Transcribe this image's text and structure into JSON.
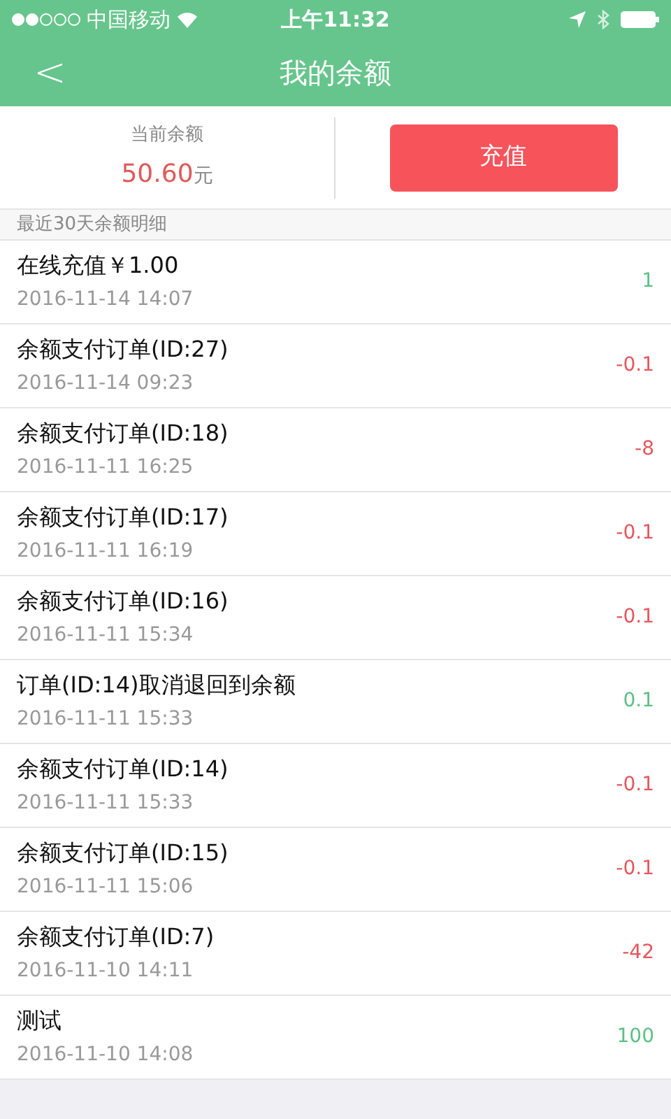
{
  "status_bar": {
    "carrier": "中国移动",
    "time": "上午11:32"
  },
  "header": {
    "back": "<",
    "title": "我的余额"
  },
  "summary": {
    "label": "当前余额",
    "amount": "50.60",
    "unit": "元",
    "button": "充值"
  },
  "section_title": "最近30天余额明细",
  "transactions": [
    {
      "title": "在线充值￥1.00",
      "time": "2016-11-14 14:07",
      "amount": "1",
      "color": "#5dbf85"
    },
    {
      "title": "余额支付订单(ID:27)",
      "time": "2016-11-14 09:23",
      "amount": "-0.1",
      "color": "#e5575c"
    },
    {
      "title": "余额支付订单(ID:18)",
      "time": "2016-11-11 16:25",
      "amount": "-8",
      "color": "#e5575c"
    },
    {
      "title": "余额支付订单(ID:17)",
      "time": "2016-11-11 16:19",
      "amount": "-0.1",
      "color": "#e5575c"
    },
    {
      "title": "余额支付订单(ID:16)",
      "time": "2016-11-11 15:34",
      "amount": "-0.1",
      "color": "#e5575c"
    },
    {
      "title": "订单(ID:14)取消退回到余额",
      "time": "2016-11-11 15:33",
      "amount": "0.1",
      "color": "#5dbf85"
    },
    {
      "title": "余额支付订单(ID:14)",
      "time": "2016-11-11 15:33",
      "amount": "-0.1",
      "color": "#e5575c"
    },
    {
      "title": "余额支付订单(ID:15)",
      "time": "2016-11-11 15:06",
      "amount": "-0.1",
      "color": "#e5575c"
    },
    {
      "title": "余额支付订单(ID:7)",
      "time": "2016-11-10 14:11",
      "amount": "-42",
      "color": "#e5575c"
    },
    {
      "title": "测试",
      "time": "2016-11-10 14:08",
      "amount": "100",
      "color": "#5dbf85"
    }
  ]
}
